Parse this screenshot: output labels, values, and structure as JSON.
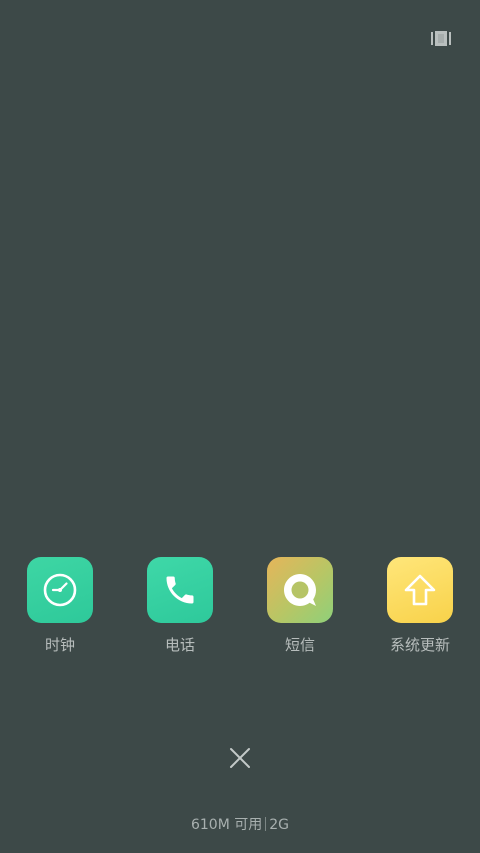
{
  "top_bar": {
    "view_toggle_icon": "card-view-icon"
  },
  "apps": [
    {
      "label": "时钟",
      "icon": "clock-icon",
      "color": "#35cfa0"
    },
    {
      "label": "电话",
      "icon": "phone-icon",
      "color": "#35cfa0"
    },
    {
      "label": "短信",
      "icon": "message-icon",
      "color": "#c8c060"
    },
    {
      "label": "系统更新",
      "icon": "upload-arrow-icon",
      "color": "#fadb5f"
    }
  ],
  "close_button": {
    "icon": "close-icon"
  },
  "memory": {
    "available": "610M 可用",
    "total": "2G"
  },
  "colors": {
    "background": "#3d4948",
    "label": "#b7bdbc"
  }
}
